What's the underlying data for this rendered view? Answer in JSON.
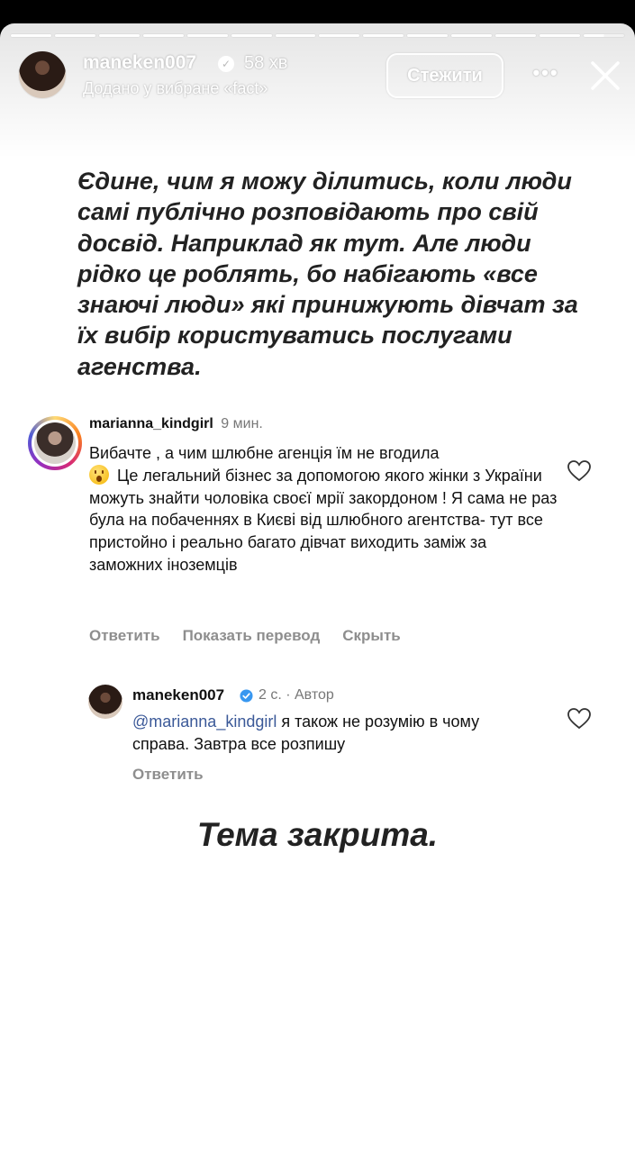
{
  "progress": {
    "segments": 14,
    "active_index": 13
  },
  "header": {
    "username": "maneken007",
    "time": "58 хв",
    "subtitle": "Додано у вибране «fact»",
    "follow_label": "Стежити"
  },
  "story": {
    "headline": "Єдине, чим я можу ділитись, коли люди самі публічно розповідають про свій досвід. Наприклад як тут. Але люди рідко це роблять, бо набігають «все знаючі люди» які принижують дівчат за їх вибір користуватись послугами агенства.",
    "closing": "Тема закрита."
  },
  "comment": {
    "username": "marianna_kindgirl",
    "time": "9 мин.",
    "text_a": "Вибачте , а чим шлюбне агенція їм не вгодила",
    "text_b": "Це легальний бізнес за допомогою якого жінки з України можуть знайти чоловіка своєї мрії закордоном ! Я сама не раз була на побаченнях в Києві від шлюбного агентства- тут все пристойно і реально багато дівчат виходить заміж за заможних іноземців",
    "actions": {
      "reply": "Ответить",
      "translate": "Показать перевод",
      "hide": "Скрыть"
    }
  },
  "reply": {
    "username": "maneken007",
    "meta": "2 с. · Автор",
    "mention": "@marianna_kindgirl",
    "text": "я також не розумію в чому справа. Завтра все розпишу",
    "reply_label": "Ответить"
  },
  "colors": {
    "verified": "#3897f0",
    "mention": "#3b5998",
    "secondary": "#8e8e8e"
  }
}
